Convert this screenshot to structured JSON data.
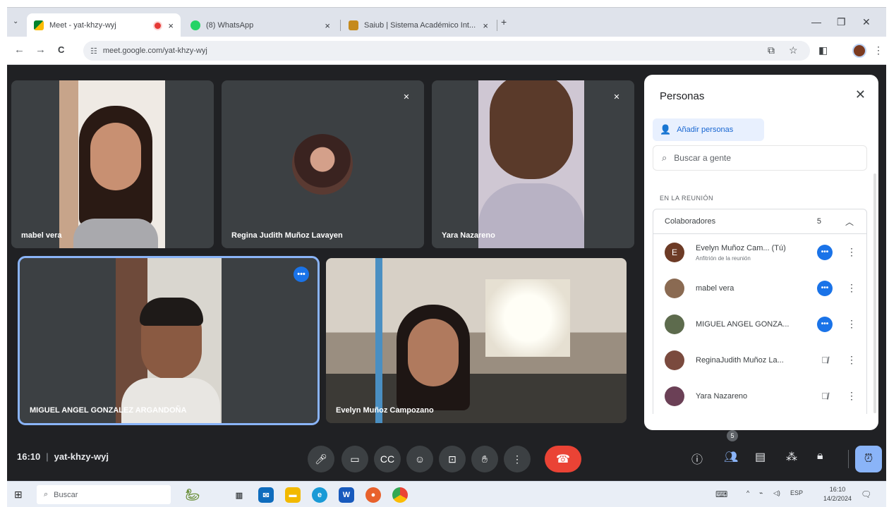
{
  "browser": {
    "tabs": [
      {
        "label": "Meet - yat-khzy-wyj",
        "active": true
      },
      {
        "label": "(8) WhatsApp",
        "active": false
      },
      {
        "label": "Saiub | Sistema Académico Int...",
        "active": false
      }
    ],
    "new_tab": "+",
    "url": "meet.google.com/yat-khzy-wyj",
    "back": "←",
    "forward": "→",
    "reload": "C",
    "minimize": "—",
    "restore": "❐",
    "close": "✕",
    "tab_close": "×"
  },
  "tiles": [
    {
      "name": "mabel vera",
      "state": ""
    },
    {
      "name": "Regina Judith Muñoz Lavayen",
      "state": "muted"
    },
    {
      "name": "Yara Nazareno",
      "state": "muted"
    },
    {
      "name": "MIGUEL ANGEL GONZALEZ ARGANDOÑA",
      "state": "speaking"
    },
    {
      "name": "Evelyn Muñoz Campozano",
      "state": ""
    }
  ],
  "people_panel": {
    "title": "Personas",
    "add_button": "Añadir personas",
    "search_placeholder": "Buscar a gente",
    "section_label": "EN LA REUNIÓN",
    "group_label": "Colaboradores",
    "group_count": "5",
    "participants": [
      {
        "name": "Evelyn Muñoz Cam... (Tú)",
        "role": "Anfitrión de la reunión",
        "avatar_letter": "E",
        "state": "active",
        "color": "#6d3b26"
      },
      {
        "name": "mabel vera",
        "role": "",
        "avatar_letter": "",
        "state": "active",
        "color": "#8a6a52"
      },
      {
        "name": "MIGUEL ANGEL GONZA...",
        "role": "",
        "avatar_letter": "",
        "state": "active",
        "color": "#5d6b4d"
      },
      {
        "name": "ReginaJudith Muñoz La...",
        "role": "",
        "avatar_letter": "",
        "state": "muted",
        "color": "#7a4a3e"
      },
      {
        "name": "Yara Nazareno",
        "role": "",
        "avatar_letter": "",
        "state": "muted",
        "color": "#6b4056"
      }
    ]
  },
  "bottom_bar": {
    "time": "16:10",
    "meeting_code": "yat-khzy-wyj",
    "people_count": "5"
  },
  "taskbar": {
    "search_placeholder": "Buscar",
    "language": "ESP",
    "clock_time": "16:10",
    "clock_date": "14/2/2024"
  },
  "colors": {
    "meet_background": "#202124",
    "tile_background": "#3c4043",
    "accent_blue": "#1a73e8",
    "end_call_red": "#ea4335"
  }
}
